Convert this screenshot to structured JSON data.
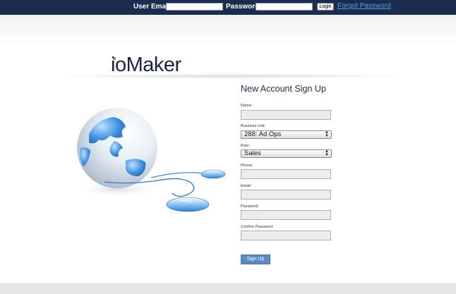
{
  "topbar": {
    "email_label": "User Email:",
    "password_label": "Password:",
    "login_label": "Login",
    "forgot_label": "Forgot Password"
  },
  "logo": {
    "text": "ioMaker"
  },
  "form": {
    "title": "New Account Sign Up",
    "name_label": "Name:",
    "business_unit_label": "Business Unit:",
    "business_unit_value": "288: Ad Ops",
    "role_label": "Role:",
    "role_value": "Sales",
    "phone_label": "Phone:",
    "email_label": "Email:",
    "password_label": "Password:",
    "confirm_password_label": "Confirm Password:",
    "signup_label": "Sign Up"
  },
  "colors": {
    "topbar": "#1b2d4f",
    "link": "#5c9bd8",
    "button": "#5b8bc7"
  }
}
